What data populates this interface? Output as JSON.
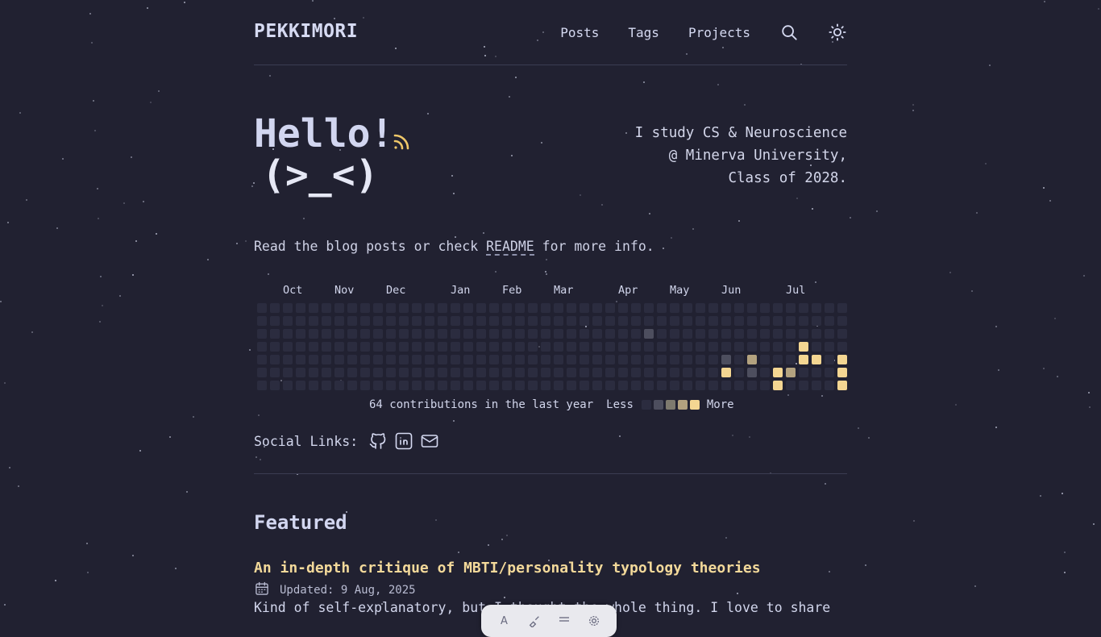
{
  "header": {
    "brand": "PEKKIMORI",
    "nav": [
      "Posts",
      "Tags",
      "Projects"
    ],
    "icons": [
      "search-icon",
      "sun-icon"
    ]
  },
  "hero": {
    "greeting": "Hello!",
    "kaomoji": "(>_<)",
    "rss_icon": "rss-icon",
    "tagline": [
      "I study CS & Neuroscience",
      "@ Minerva University,",
      "Class of 2028."
    ],
    "intro": {
      "before": "Read the blog posts or check ",
      "link": "README",
      "after": " for more info."
    }
  },
  "contributions": {
    "months": [
      "Oct",
      "Nov",
      "Dec",
      "Jan",
      "Feb",
      "Mar",
      "Apr",
      "May",
      "Jun",
      "Jul"
    ],
    "summary": "64 contributions in the last year",
    "less_label": "Less",
    "more_label": "More",
    "level_colors": [
      "#2b2c3f",
      "#4d4e5e",
      "#7e7a6e",
      "#b3a27f",
      "#f4d692"
    ],
    "active_cells": [
      {
        "week": 30,
        "day": 2,
        "level": 1
      },
      {
        "week": 36,
        "day": 4,
        "level": 1
      },
      {
        "week": 38,
        "day": 4,
        "level": 3
      },
      {
        "week": 36,
        "day": 5,
        "level": 4
      },
      {
        "week": 38,
        "day": 5,
        "level": 1
      },
      {
        "week": 42,
        "day": 3,
        "level": 4
      },
      {
        "week": 42,
        "day": 4,
        "level": 4
      },
      {
        "week": 43,
        "day": 4,
        "level": 4
      },
      {
        "week": 45,
        "day": 4,
        "level": 4
      },
      {
        "week": 40,
        "day": 5,
        "level": 4
      },
      {
        "week": 41,
        "day": 5,
        "level": 3
      },
      {
        "week": 45,
        "day": 5,
        "level": 4
      },
      {
        "week": 40,
        "day": 6,
        "level": 4
      },
      {
        "week": 45,
        "day": 6,
        "level": 4
      }
    ]
  },
  "social": {
    "label": "Social Links:",
    "icons": [
      "github-icon",
      "linkedin-icon",
      "mail-icon"
    ]
  },
  "featured": {
    "heading": "Featured",
    "post": {
      "title": "An in-depth critique of MBTI/personality typology theories",
      "date": "Updated: 9 Aug, 2025",
      "excerpt": "Kind of self-explanatory, but I thought the whole thing. I love to share"
    }
  }
}
